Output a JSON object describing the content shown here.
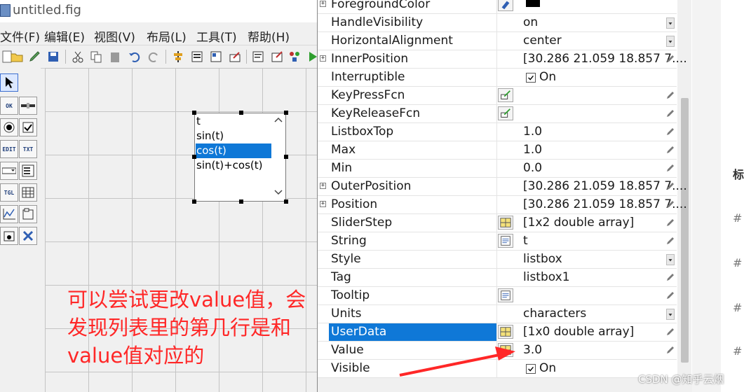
{
  "window": {
    "title": "untitled.fig"
  },
  "menu": [
    "文件(F)",
    "编辑(E)",
    "视图(V)",
    "布局(L)",
    "工具(T)",
    "帮助(H)"
  ],
  "palette_labels": {
    "push": "OK",
    "edit": "EDIT",
    "text": "TXT",
    "toggle": "TGL"
  },
  "listbox": {
    "items": [
      "t",
      "sin(t)",
      "cos(t)",
      "sin(t)+cos(t)"
    ],
    "selected_index": 2
  },
  "annotation": {
    "text": "可以尝试更改value值，会发现列表里的第几行是和value值对应的"
  },
  "properties": [
    {
      "name": "ForegroundColor",
      "value": "",
      "expand": true,
      "button": "color",
      "swatch": "#000000",
      "control": "none"
    },
    {
      "name": "HandleVisibility",
      "value": "on",
      "control": "dropdown"
    },
    {
      "name": "HorizontalAlignment",
      "value": "center",
      "control": "dropdown"
    },
    {
      "name": "InnerPosition",
      "value": "[30.286 21.059 18.857 7....",
      "expand": true,
      "control": "pencil"
    },
    {
      "name": "Interruptible",
      "value": "On",
      "control": "checkbox"
    },
    {
      "name": "KeyPressFcn",
      "value": "",
      "button": "callback",
      "control": "pencil"
    },
    {
      "name": "KeyReleaseFcn",
      "value": "",
      "button": "callback",
      "control": "pencil"
    },
    {
      "name": "ListboxTop",
      "value": "1.0",
      "control": "pencil"
    },
    {
      "name": "Max",
      "value": "1.0",
      "control": "pencil"
    },
    {
      "name": "Min",
      "value": "0.0",
      "control": "pencil"
    },
    {
      "name": "OuterPosition",
      "value": "[30.286 21.059 18.857 7....",
      "expand": true,
      "control": "pencil"
    },
    {
      "name": "Position",
      "value": "[30.286 21.059 18.857 7....",
      "expand": true,
      "control": "pencil"
    },
    {
      "name": "SliderStep",
      "value": "[1x2  double array]",
      "button": "array",
      "control": "pencil"
    },
    {
      "name": "String",
      "value": "t",
      "button": "text",
      "control": "pencil"
    },
    {
      "name": "Style",
      "value": "listbox",
      "control": "dropdown"
    },
    {
      "name": "Tag",
      "value": "listbox1",
      "control": "pencil"
    },
    {
      "name": "Tooltip",
      "value": "",
      "button": "text",
      "control": "pencil"
    },
    {
      "name": "Units",
      "value": "characters",
      "control": "dropdown"
    },
    {
      "name": "UserData",
      "value": "[1x0  double array]",
      "button": "array",
      "control": "pencil",
      "highlight": true
    },
    {
      "name": "Value",
      "value": "3.0",
      "button": "array",
      "control": "pencil"
    },
    {
      "name": "Visible",
      "value": "On",
      "control": "checkbox"
    }
  ],
  "right_panel": {
    "chars": [
      "标",
      "#",
      "#",
      "#",
      "#"
    ]
  },
  "watermark": "CSDN @知乎云烟",
  "colors": {
    "selection": "#0f78d7",
    "annotation": "#ff2727",
    "arrow": "#ff2727"
  }
}
